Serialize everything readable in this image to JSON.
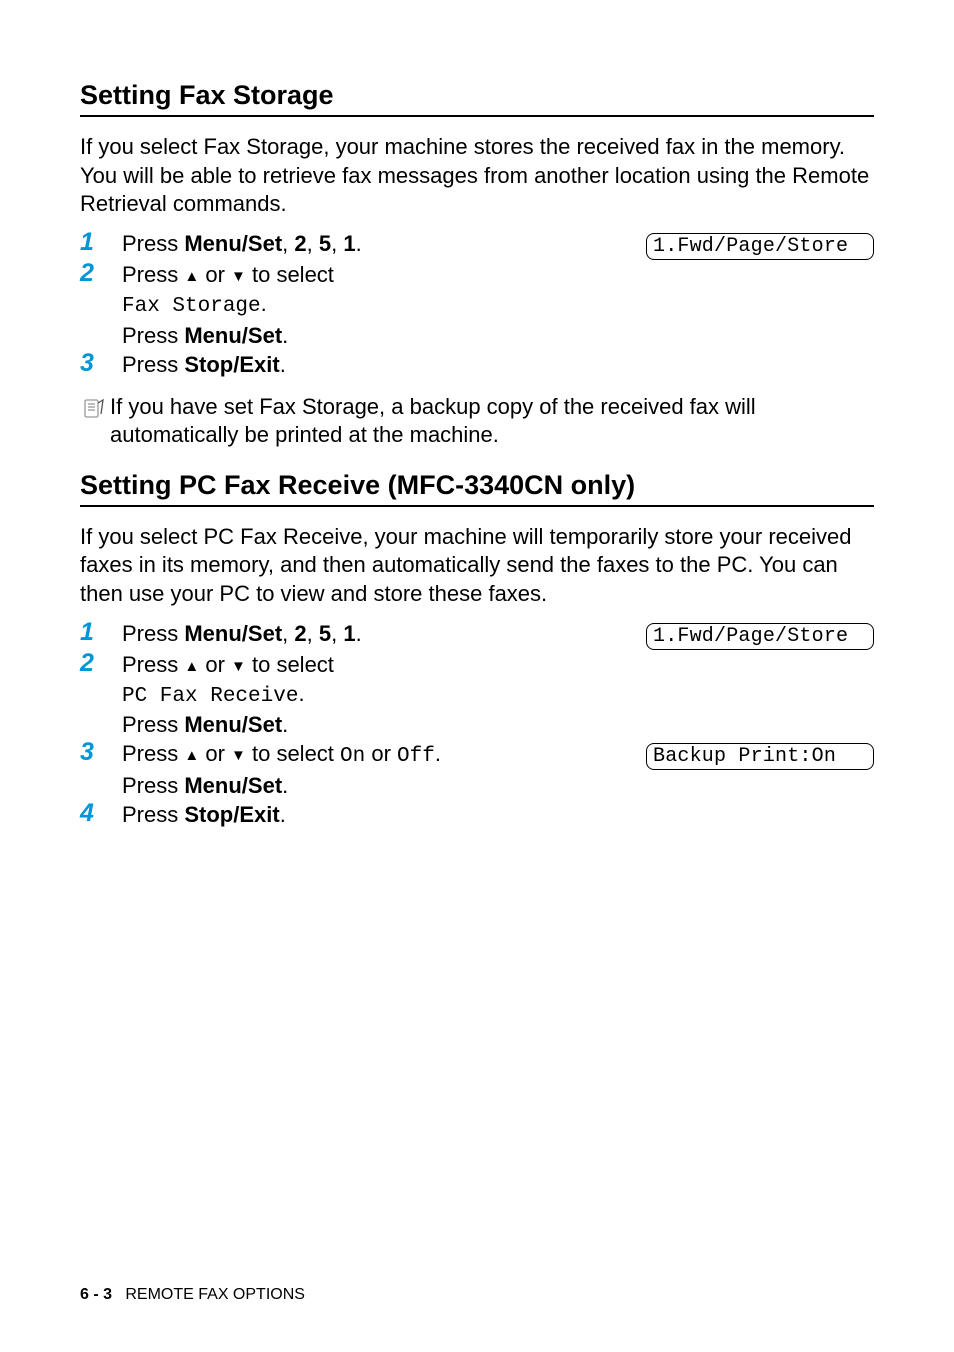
{
  "section1": {
    "heading": "Setting Fax Storage",
    "intro": "If you select Fax Storage, your machine stores the received fax in the memory. You will be able to retrieve fax messages from another location using the Remote Retrieval commands.",
    "steps": {
      "s1": {
        "num": "1",
        "pre": "Press ",
        "key": "Menu/Set",
        "post": ", ",
        "k2": "2",
        "k3": "5",
        "k4": "1",
        "end": ".",
        "display": "1.Fwd/Page/Store"
      },
      "s2": {
        "num": "2",
        "line1a": "Press ",
        "line1b": " or ",
        "line1c": " to select",
        "line2": "Fax Storage",
        "line2end": ".",
        "line3a": "Press ",
        "line3key": "Menu/Set",
        "line3end": "."
      },
      "s3": {
        "num": "3",
        "pre": "Press ",
        "key": "Stop/Exit",
        "end": "."
      }
    },
    "note": "If you have set Fax Storage, a backup copy of the received fax will automatically be printed at the machine."
  },
  "section2": {
    "heading": "Setting PC Fax Receive (MFC-3340CN only)",
    "intro": "If you select PC Fax Receive, your machine will temporarily store your received faxes in its memory, and then automatically send the faxes to the PC. You can then use your PC to view and store these faxes.",
    "steps": {
      "s1": {
        "num": "1",
        "pre": "Press ",
        "key": "Menu/Set",
        "post": ", ",
        "k2": "2",
        "k3": "5",
        "k4": "1",
        "end": ".",
        "display": "1.Fwd/Page/Store"
      },
      "s2": {
        "num": "2",
        "line1a": "Press ",
        "line1b": " or ",
        "line1c": " to select",
        "line2": "PC Fax Receive",
        "line2end": ".",
        "line3a": "Press ",
        "line3key": "Menu/Set",
        "line3end": "."
      },
      "s3": {
        "num": "3",
        "line1a": "Press ",
        "line1b": " or ",
        "line1c": " to select ",
        "on": "On",
        "or": " or ",
        "off": "Off",
        "end": ".",
        "line2a": "Press ",
        "line2key": "Menu/Set",
        "line2end": ".",
        "display": "Backup Print:On "
      },
      "s4": {
        "num": "4",
        "pre": "Press ",
        "key": "Stop/Exit",
        "end": "."
      }
    }
  },
  "footer": {
    "pagenum": "6 - 3",
    "title": "REMOTE FAX OPTIONS"
  },
  "glyphs": {
    "up": "▲",
    "down": "▼"
  }
}
